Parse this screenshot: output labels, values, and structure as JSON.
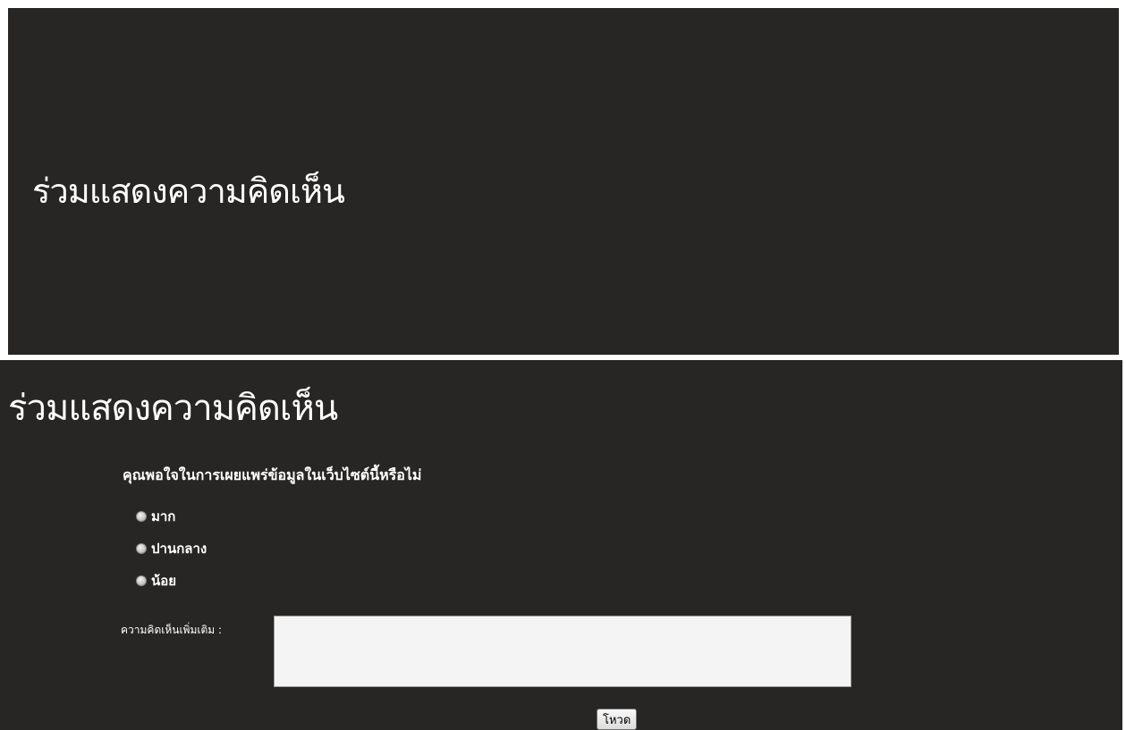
{
  "banner": {
    "title": "ร่วมแสดงความคิดเห็น"
  },
  "poll": {
    "title": "ร่วมแสดงความคิดเห็น",
    "question": "คุณพอใจในการเผยแพร่ข้อมูลในเว็บไซต์นี้หรือไม่",
    "options": [
      {
        "label": "มาก"
      },
      {
        "label": "ปานกลาง"
      },
      {
        "label": "น้อย"
      }
    ],
    "comment_label": "ความคิดเห็นเพิ่มเติม :",
    "comment_value": "",
    "submit_label": "โหวด"
  }
}
